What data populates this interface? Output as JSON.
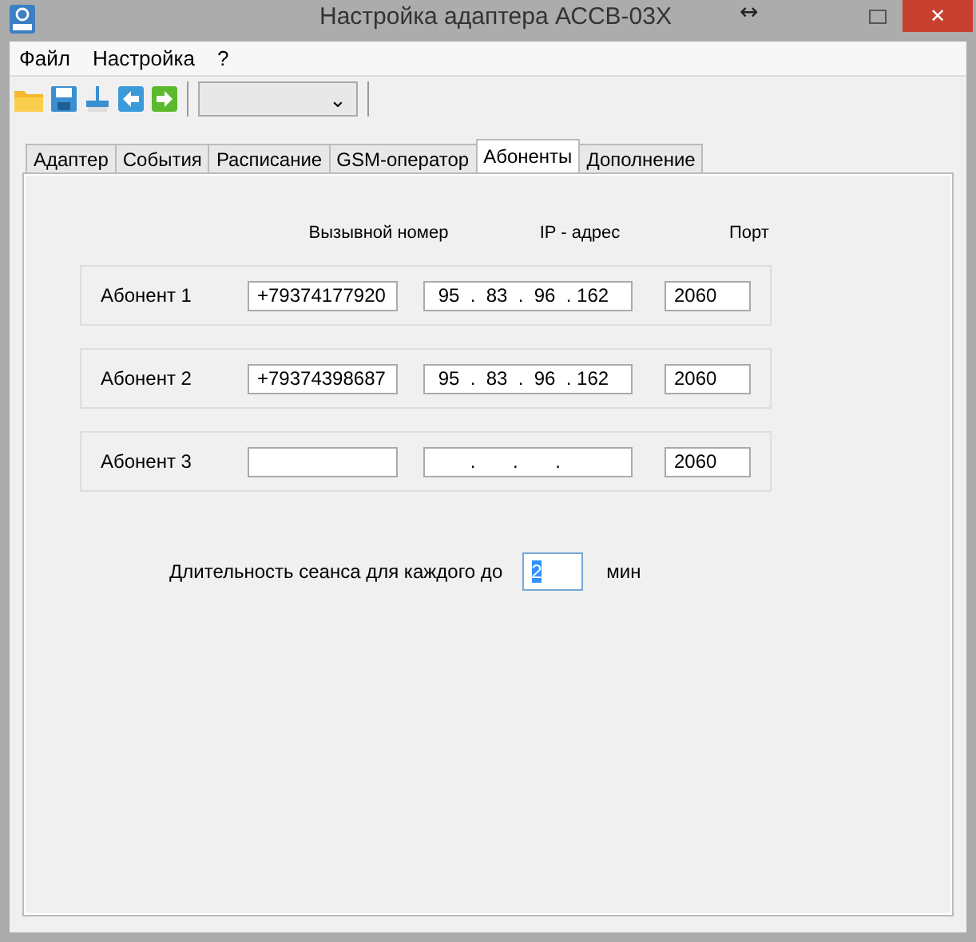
{
  "window": {
    "title": "Настройка адаптера АССВ-03Х",
    "resize_glyph": "↔",
    "close_glyph": "✕"
  },
  "menu": [
    "Файл",
    "Настройка",
    "?"
  ],
  "toolbar": {
    "dropdown_arrow": "⌄"
  },
  "tabs": [
    {
      "label": "Адаптер",
      "selected": false
    },
    {
      "label": "События",
      "selected": false
    },
    {
      "label": "Расписание",
      "selected": false
    },
    {
      "label": "GSM-оператор",
      "selected": false
    },
    {
      "label": "Абоненты",
      "selected": true
    },
    {
      "label": "Дополнение",
      "selected": false
    }
  ],
  "columns": [
    "Вызывной номер",
    "IP - адрес",
    "Порт"
  ],
  "subscribers": [
    {
      "label": "Абонент 1",
      "phone": "+79374177920",
      "ip": " 95  .  83  .  96  . 162",
      "port": "2060"
    },
    {
      "label": "Абонент 2",
      "phone": "+79374398687",
      "ip": " 95  .  83  .  96  . 162",
      "port": "2060"
    },
    {
      "label": "Абонент 3",
      "ip": "       .       .       .",
      "port": "2060"
    }
  ],
  "session": {
    "label": "Длительность сеанса для каждого до",
    "value": "2",
    "selected": true,
    "unit": "мин"
  }
}
